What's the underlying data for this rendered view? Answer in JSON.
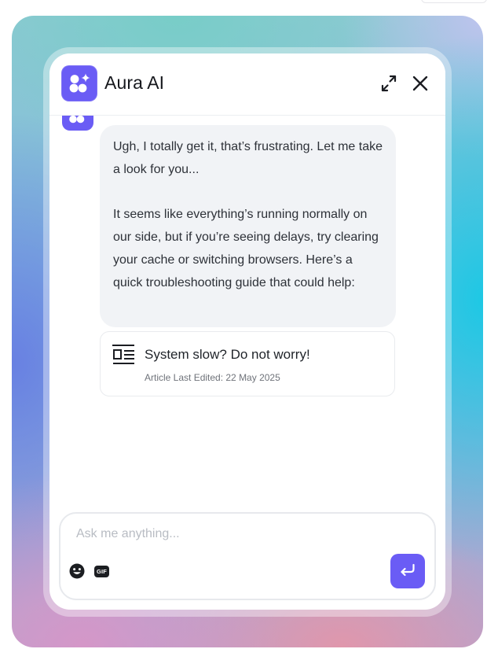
{
  "app": {
    "title": "Aura AI",
    "logo_icon": "aura-sparkle-logo",
    "accent_color": "#6a5cf5"
  },
  "header": {
    "expand_icon": "expand-arrows-icon",
    "close_icon": "close-icon"
  },
  "messages": [
    {
      "sender": "bot",
      "text": "Ugh, I totally get it, that’s frustrating. Let me take a look for you...\n\nIt seems like everything’s running normally on our side, but if you’re seeing delays, try clearing your cache or switching browsers. Here’s a quick troubleshooting guide that could help:"
    }
  ],
  "article": {
    "icon": "article-icon",
    "title": "System slow? Do not worry!",
    "meta": "Article Last Edited: 22 May 2025"
  },
  "composer": {
    "value": "",
    "placeholder": "Ask me anything...",
    "emoji_icon": "emoji-icon",
    "gif_label": "GIF",
    "send_icon": "enter-arrow-icon"
  }
}
